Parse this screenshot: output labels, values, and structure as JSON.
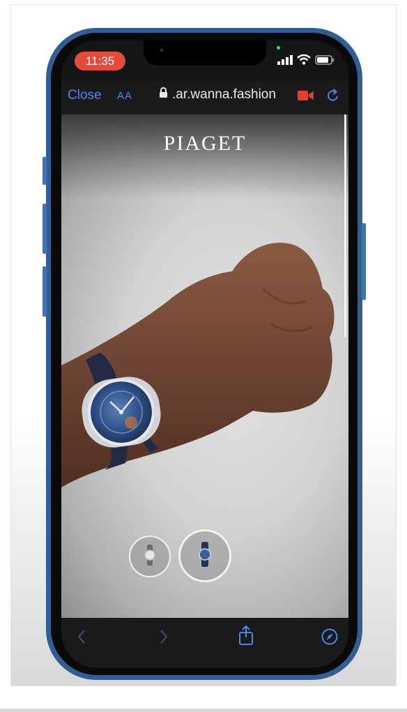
{
  "status_bar": {
    "time": "11:35"
  },
  "browser": {
    "close_label": "Close",
    "text_size_label": "AA",
    "url": ".ar.wanna.fashion"
  },
  "brand": {
    "name_first": "P",
    "name_rest": "IAGE",
    "name_last": "T"
  },
  "watch_options": [
    {
      "name": "watch-option-silver",
      "selected": false
    },
    {
      "name": "watch-option-blue",
      "selected": true
    }
  ],
  "colors": {
    "accent": "#4a88e6",
    "time_pill": "#e64a3c",
    "phone_frame": "#2f5f93",
    "watch_dial": "#2d4f86"
  },
  "icons": [
    "lock-icon",
    "camera-icon",
    "reload-icon",
    "back-icon",
    "forward-icon",
    "share-icon",
    "compass-icon",
    "signal-icon",
    "wifi-icon",
    "battery-icon"
  ]
}
